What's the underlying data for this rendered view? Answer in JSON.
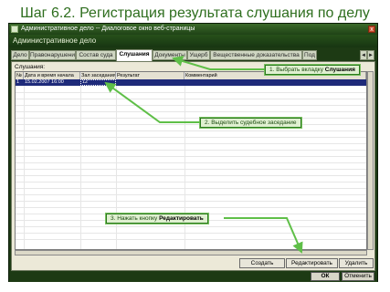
{
  "slide": {
    "title": "Шаг 6.2. Регистрация результата слушания по делу"
  },
  "window": {
    "title": "Административное дело -- Диалоговое окно веб-страницы",
    "close_label": "x"
  },
  "app": {
    "header": "Административное дело"
  },
  "tabs": [
    {
      "label": "Дело"
    },
    {
      "label": "Правонарушение"
    },
    {
      "label": "Состав суда"
    },
    {
      "label": "Слушания"
    },
    {
      "label": "Документы"
    },
    {
      "label": "Ущерб"
    },
    {
      "label": "Вещественные доказательства"
    },
    {
      "label": "Под"
    }
  ],
  "tab_arrows": {
    "left": "◄",
    "right": "►"
  },
  "panel": {
    "caption": "Слушания:"
  },
  "grid": {
    "columns": [
      "№",
      "Дата и время начала",
      "Зал заседания",
      "Результат",
      "Комментарий"
    ],
    "rows": [
      {
        "num": "1",
        "date": "15.02.2007 16:00",
        "room": "12",
        "result": "",
        "comment": ""
      }
    ]
  },
  "buttons": {
    "create": "Создать",
    "edit": "Редактировать",
    "delete": "Удалить"
  },
  "footer": {
    "ok": "ОК",
    "cancel": "Отменить"
  },
  "callouts": {
    "step1_prefix": "1. Выбрать вкладку ",
    "step1_bold": "Слушания",
    "step2": "2. Выделить судебное заседание",
    "step3_prefix": "3. Нажать кнопку ",
    "step3_bold": "Редактировать"
  },
  "colors": {
    "window_dark": "#1d3a14",
    "selection": "#1e2a7a",
    "callout_border": "#2b7a1e",
    "title_green": "#2e6e1e"
  }
}
